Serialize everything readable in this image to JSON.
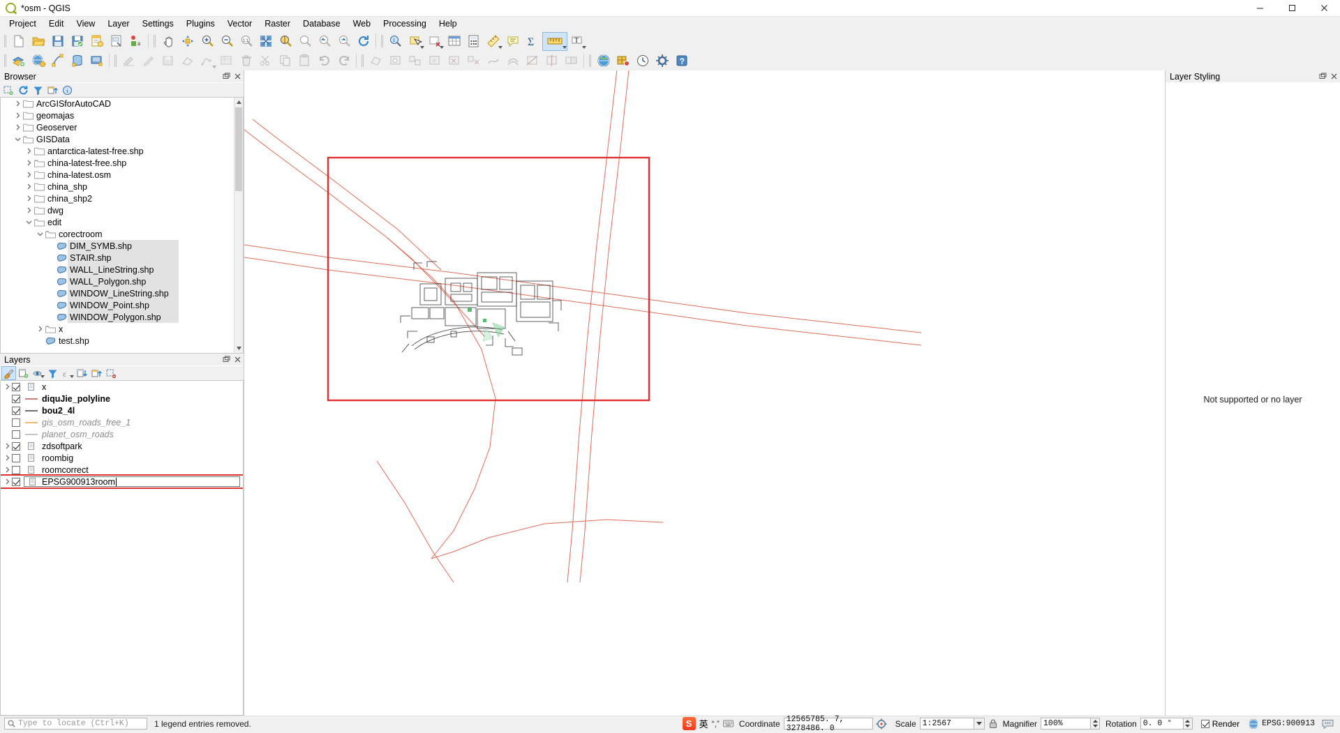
{
  "window": {
    "title": "*osm - QGIS",
    "logo_icon": "qgis-logo-icon",
    "minimize_icon": "minimize-icon",
    "maximize_icon": "maximize-icon",
    "close_icon": "close-icon"
  },
  "menubar": {
    "items": [
      {
        "label": "Project"
      },
      {
        "label": "Edit"
      },
      {
        "label": "View"
      },
      {
        "label": "Layer"
      },
      {
        "label": "Settings"
      },
      {
        "label": "Plugins"
      },
      {
        "label": "Vector"
      },
      {
        "label": "Raster"
      },
      {
        "label": "Database"
      },
      {
        "label": "Web"
      },
      {
        "label": "Processing"
      },
      {
        "label": "Help"
      }
    ]
  },
  "browser": {
    "title": "Browser",
    "toolbar": [
      {
        "name": "add-selected-layers-icon"
      },
      {
        "name": "refresh-icon"
      },
      {
        "name": "filter-browser-icon"
      },
      {
        "name": "collapse-all-icon"
      },
      {
        "name": "properties-info-icon"
      }
    ],
    "tree": [
      {
        "label": "ArcGISforAutoCAD",
        "indent": 1,
        "expandable": true,
        "expanded": false,
        "icon": "folder-icon"
      },
      {
        "label": "geomajas",
        "indent": 1,
        "expandable": true,
        "expanded": false,
        "icon": "folder-icon"
      },
      {
        "label": "Geoserver",
        "indent": 1,
        "expandable": true,
        "expanded": false,
        "icon": "folder-icon"
      },
      {
        "label": "GISData",
        "indent": 1,
        "expandable": true,
        "expanded": true,
        "icon": "folder-open-icon"
      },
      {
        "label": "antarctica-latest-free.shp",
        "indent": 2,
        "expandable": true,
        "expanded": false,
        "icon": "folder-icon"
      },
      {
        "label": "china-latest-free.shp",
        "indent": 2,
        "expandable": true,
        "expanded": false,
        "icon": "folder-open-icon"
      },
      {
        "label": "china-latest.osm",
        "indent": 2,
        "expandable": true,
        "expanded": false,
        "icon": "folder-icon"
      },
      {
        "label": "china_shp",
        "indent": 2,
        "expandable": true,
        "expanded": false,
        "icon": "folder-icon"
      },
      {
        "label": "china_shp2",
        "indent": 2,
        "expandable": true,
        "expanded": false,
        "icon": "folder-icon"
      },
      {
        "label": "dwg",
        "indent": 2,
        "expandable": true,
        "expanded": false,
        "icon": "folder-icon"
      },
      {
        "label": "edit",
        "indent": 2,
        "expandable": true,
        "expanded": true,
        "icon": "folder-open-icon"
      },
      {
        "label": "corectroom",
        "indent": 3,
        "expandable": true,
        "expanded": true,
        "icon": "folder-open-icon"
      },
      {
        "label": "DIM_SYMB.shp",
        "indent": 4,
        "expandable": false,
        "expanded": false,
        "icon": "polygon-layer-icon",
        "selected": true
      },
      {
        "label": "STAIR.shp",
        "indent": 4,
        "expandable": false,
        "expanded": false,
        "icon": "polygon-layer-icon",
        "selected": true
      },
      {
        "label": "WALL_LineString.shp",
        "indent": 4,
        "expandable": false,
        "expanded": false,
        "icon": "polygon-layer-icon",
        "selected": true
      },
      {
        "label": "WALL_Polygon.shp",
        "indent": 4,
        "expandable": false,
        "expanded": false,
        "icon": "polygon-layer-icon",
        "selected": true
      },
      {
        "label": "WINDOW_LineString.shp",
        "indent": 4,
        "expandable": false,
        "expanded": false,
        "icon": "polygon-layer-icon",
        "selected": true
      },
      {
        "label": "WINDOW_Point.shp",
        "indent": 4,
        "expandable": false,
        "expanded": false,
        "icon": "polygon-layer-icon",
        "selected": true
      },
      {
        "label": "WINDOW_Polygon.shp",
        "indent": 4,
        "expandable": false,
        "expanded": false,
        "icon": "polygon-layer-icon",
        "selected": true
      },
      {
        "label": "x",
        "indent": 3,
        "expandable": true,
        "expanded": false,
        "icon": "folder-open-icon"
      },
      {
        "label": "test.shp",
        "indent": 3,
        "expandable": false,
        "expanded": false,
        "icon": "polygon-layer-icon"
      }
    ]
  },
  "layers": {
    "title": "Layers",
    "toolbar": [
      {
        "name": "open-layer-styling-panel-icon",
        "active": true
      },
      {
        "name": "add-group-icon",
        "active": false
      },
      {
        "name": "manage-layer-visibility-icon",
        "active": false
      },
      {
        "name": "filter-legend-icon",
        "active": false
      },
      {
        "name": "filter-legend-expression-icon",
        "active": false
      },
      {
        "name": "expand-all-icon",
        "active": false
      },
      {
        "name": "collapse-all-icon",
        "active": false
      },
      {
        "name": "remove-layer-icon",
        "active": false
      }
    ],
    "items": [
      {
        "label": "x",
        "checked": true,
        "group": true,
        "expandable": true,
        "symbol": "group-icon",
        "style": "normal"
      },
      {
        "label": "diquJie_polyline",
        "checked": true,
        "group": false,
        "expandable": false,
        "symbol": "line-red-icon",
        "style": "bold"
      },
      {
        "label": "bou2_4l",
        "checked": true,
        "group": false,
        "expandable": false,
        "symbol": "line-dark-icon",
        "style": "bold"
      },
      {
        "label": "gis_osm_roads_free_1",
        "checked": false,
        "group": false,
        "expandable": false,
        "symbol": "line-orange-icon",
        "style": "italic-grey"
      },
      {
        "label": "planet_osm_roads",
        "checked": false,
        "group": false,
        "expandable": false,
        "symbol": "line-grey-icon",
        "style": "italic-grey"
      },
      {
        "label": "zdsoftpark",
        "checked": true,
        "group": true,
        "expandable": true,
        "symbol": "group-icon",
        "style": "normal"
      },
      {
        "label": "roombig",
        "checked": false,
        "group": true,
        "expandable": true,
        "symbol": "group-icon",
        "style": "normal"
      },
      {
        "label": "roomcorrect",
        "checked": false,
        "group": true,
        "expandable": true,
        "symbol": "group-icon",
        "style": "normal"
      },
      {
        "label": "EPSG900913room",
        "checked": true,
        "group": true,
        "expandable": true,
        "symbol": "group-icon",
        "style": "normal",
        "editing": true
      }
    ],
    "editing_value": "EPSG900913room",
    "highlight_color": "#e03131"
  },
  "layer_styling": {
    "title": "Layer Styling",
    "empty_message": "Not supported or no layer",
    "dock_float_icon": "float-dock-icon",
    "dock_close_icon": "close-dock-icon"
  },
  "statusbar": {
    "locator_placeholder": "Type to locate (Ctrl+K)",
    "locator_icon": "search-icon",
    "message": "1 legend entries removed.",
    "coordinate_label": "Coordinate",
    "coordinate_value": "12565785. 7, 3278486. 0",
    "coordinate_toggle_icon": "coordinate-capture-icon",
    "scale_label": "Scale",
    "scale_value": "1:2567",
    "magnifier_label": "Magnifier",
    "magnifier_value": "100%",
    "magnifier_lock_icon": "lock-icon",
    "rotation_label": "Rotation",
    "rotation_value": "0. 0 °",
    "render_label": "Render",
    "render_checked": true,
    "crs_value": "EPSG:900913",
    "crs_icon": "crs-globe-icon",
    "message_log_icon": "message-log-icon",
    "ime": {
      "app_icon": "sogou-ime-icon",
      "mode": "英",
      "punctuation_icon": "punctuation-icon",
      "keyboard_icon": "keyboard-icon"
    }
  },
  "toolbar_rows": [
    {
      "groups": [
        {
          "buttons": [
            {
              "name": "new-project-icon"
            },
            {
              "name": "open-project-icon"
            },
            {
              "name": "save-project-icon"
            },
            {
              "name": "save-project-as-icon"
            },
            {
              "name": "new-print-layout-icon"
            },
            {
              "name": "layout-manager-icon"
            },
            {
              "name": "style-manager-icon"
            }
          ]
        },
        {
          "buttons": [
            {
              "name": "pan-map-icon"
            },
            {
              "name": "pan-to-selection-icon"
            },
            {
              "name": "zoom-in-icon"
            },
            {
              "name": "zoom-out-icon"
            },
            {
              "name": "zoom-native-icon"
            },
            {
              "name": "zoom-full-icon"
            },
            {
              "name": "zoom-to-selection-icon"
            },
            {
              "name": "zoom-to-layer-icon"
            },
            {
              "name": "zoom-last-icon"
            },
            {
              "name": "zoom-next-icon"
            },
            {
              "name": "refresh-map-icon"
            }
          ]
        },
        {
          "buttons": [
            {
              "name": "identify-features-icon"
            },
            {
              "name": "select-features-icon",
              "has_menu": true
            },
            {
              "name": "deselect-features-icon",
              "has_menu": true
            },
            {
              "name": "open-attribute-table-icon"
            },
            {
              "name": "field-calculator-icon"
            },
            {
              "name": "measure-line-icon",
              "has_menu": true
            },
            {
              "name": "show-map-tips-icon"
            },
            {
              "name": "statistical-summary-icon"
            },
            {
              "name": "measurement-bar-icon",
              "has_menu": true,
              "active": true
            },
            {
              "name": "new-text-annotation-icon",
              "has_menu": true
            }
          ]
        }
      ]
    },
    {
      "groups": [
        {
          "buttons": [
            {
              "name": "add-vector-layer-icon"
            },
            {
              "name": "add-raster-layer-icon"
            },
            {
              "name": "add-delimited-text-layer-icon"
            },
            {
              "name": "add-postgis-layer-icon"
            },
            {
              "name": "add-spatialite-layer-icon"
            }
          ]
        },
        {
          "buttons": [
            {
              "name": "current-edits-icon",
              "disabled": true
            },
            {
              "name": "toggle-editing-icon",
              "disabled": true
            },
            {
              "name": "save-layer-edits-icon",
              "disabled": true
            },
            {
              "name": "add-feature-icon",
              "disabled": true
            },
            {
              "name": "vertex-tool-icon",
              "disabled": true,
              "has_menu": true
            },
            {
              "name": "modify-attributes-icon",
              "disabled": true
            },
            {
              "name": "delete-selected-icon",
              "disabled": true
            },
            {
              "name": "cut-features-icon",
              "disabled": true
            },
            {
              "name": "copy-features-icon",
              "disabled": true
            },
            {
              "name": "paste-features-icon",
              "disabled": true
            },
            {
              "name": "undo-icon",
              "disabled": true
            },
            {
              "name": "redo-icon",
              "disabled": true
            }
          ]
        },
        {
          "buttons": [
            {
              "name": "add-polygon-feature-icon",
              "disabled": true
            },
            {
              "name": "add-ring-icon",
              "disabled": true
            },
            {
              "name": "add-part-icon",
              "disabled": true
            },
            {
              "name": "fill-ring-icon",
              "disabled": true
            },
            {
              "name": "delete-ring-icon",
              "disabled": true
            },
            {
              "name": "delete-part-icon",
              "disabled": true
            },
            {
              "name": "reshape-features-icon",
              "disabled": true
            },
            {
              "name": "offset-curve-icon",
              "disabled": true
            },
            {
              "name": "split-features-icon",
              "disabled": true
            },
            {
              "name": "split-parts-icon",
              "disabled": true
            },
            {
              "name": "merge-features-icon",
              "disabled": true
            }
          ]
        },
        {
          "buttons": [
            {
              "name": "metasearch-globe-icon"
            },
            {
              "name": "georeferencer-icon"
            },
            {
              "name": "temporal-controller-icon"
            },
            {
              "name": "processing-toolbox-icon"
            },
            {
              "name": "help-contents-icon"
            }
          ]
        }
      ]
    }
  ],
  "map": {
    "highlight_rect_color": "#e03131",
    "road_color": "#e06c5a"
  }
}
